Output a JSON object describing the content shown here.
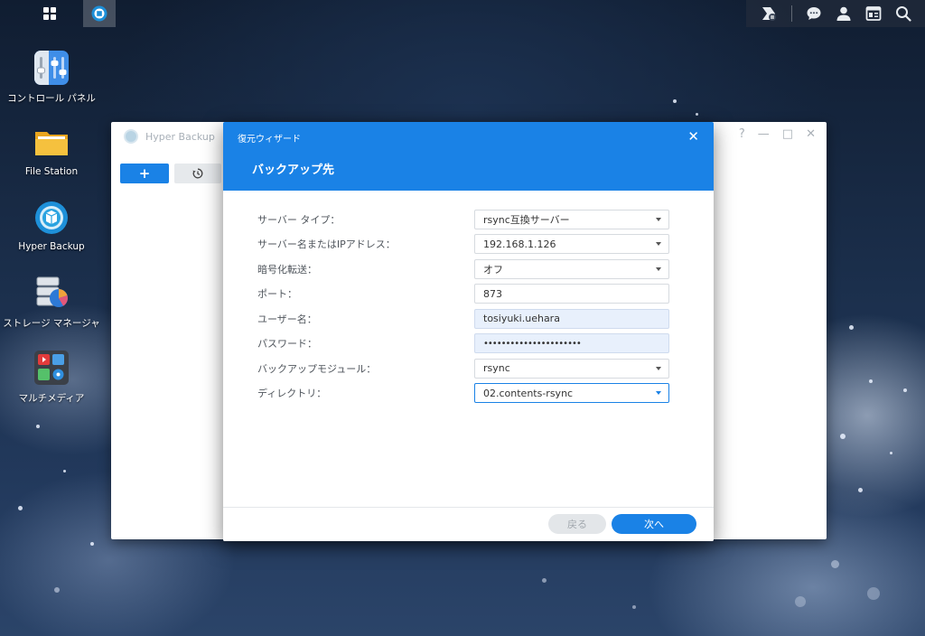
{
  "desktop": {
    "icons": [
      {
        "label": "コントロール パネル"
      },
      {
        "label": "File Station"
      },
      {
        "label": "Hyper Backup"
      },
      {
        "label": "ストレージ マネージャ"
      },
      {
        "label": "マルチメディア"
      }
    ]
  },
  "background_window": {
    "title": "Hyper Backup",
    "add_label": "+",
    "help_label": "?",
    "minimize_label": "—",
    "maximize_label": "□",
    "close_label": "✕"
  },
  "dialog": {
    "wizard_title": "復元ウィザード",
    "close_label": "✕",
    "subtitle": "バックアップ先",
    "fields": [
      {
        "label": "サーバー タイプ：",
        "value": "rsync互換サーバー"
      },
      {
        "label": "サーバー名またはIPアドレス：",
        "value": "192.168.1.126"
      },
      {
        "label": "暗号化転送：",
        "value": "オフ"
      },
      {
        "label": "ポート：",
        "value": "873"
      },
      {
        "label": "ユーザー名：",
        "value": "tosiyuki.uehara"
      },
      {
        "label": "パスワード：",
        "value": "••••••••••••••••••••••"
      },
      {
        "label": "バックアップモジュール：",
        "value": "rsync"
      },
      {
        "label": "ディレクトリ：",
        "value": "02.contents-rsync"
      }
    ],
    "back_label": "戻る",
    "next_label": "次へ"
  },
  "colors": {
    "accent": "#1a82e6",
    "filled_field": "#e8f0fc"
  }
}
